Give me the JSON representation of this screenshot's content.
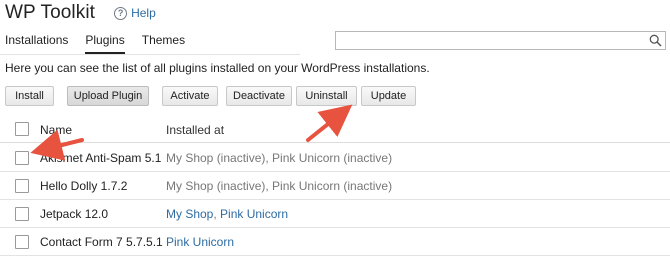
{
  "header": {
    "title": "WP Toolkit",
    "help_label": "Help",
    "help_icon": "question-circle-icon"
  },
  "tabs": [
    {
      "label": "Installations",
      "active": false
    },
    {
      "label": "Plugins",
      "active": true
    },
    {
      "label": "Themes",
      "active": false
    }
  ],
  "search": {
    "value": "",
    "placeholder": "",
    "icon": "search-icon"
  },
  "intro_text": "Here you can see the list of all plugins installed on your WordPress installations.",
  "toolbar": {
    "install": "Install",
    "upload": "Upload Plugin",
    "activate": "Activate",
    "deactivate": "Deactivate",
    "uninstall": "Uninstall",
    "update": "Update"
  },
  "table": {
    "columns": {
      "name": "Name",
      "installed_at": "Installed at"
    },
    "rows": [
      {
        "name": "Akismet Anti-Spam 5.1",
        "installed_at": "My Shop (inactive), Pink Unicorn (inactive)",
        "links": false
      },
      {
        "name": "Hello Dolly 1.7.2",
        "installed_at": "My Shop (inactive), Pink Unicorn (inactive)",
        "links": false
      },
      {
        "name": "Jetpack 12.0",
        "site_a": "My Shop",
        "sep": ", ",
        "site_b": "Pink Unicorn",
        "links": true
      },
      {
        "name": "Contact Form 7 5.7.5.1",
        "site_a": "Pink Unicorn",
        "links": true
      }
    ]
  },
  "colors": {
    "link": "#2d6ca2",
    "muted": "#777777",
    "annotation_arrow": "#e8533f"
  }
}
